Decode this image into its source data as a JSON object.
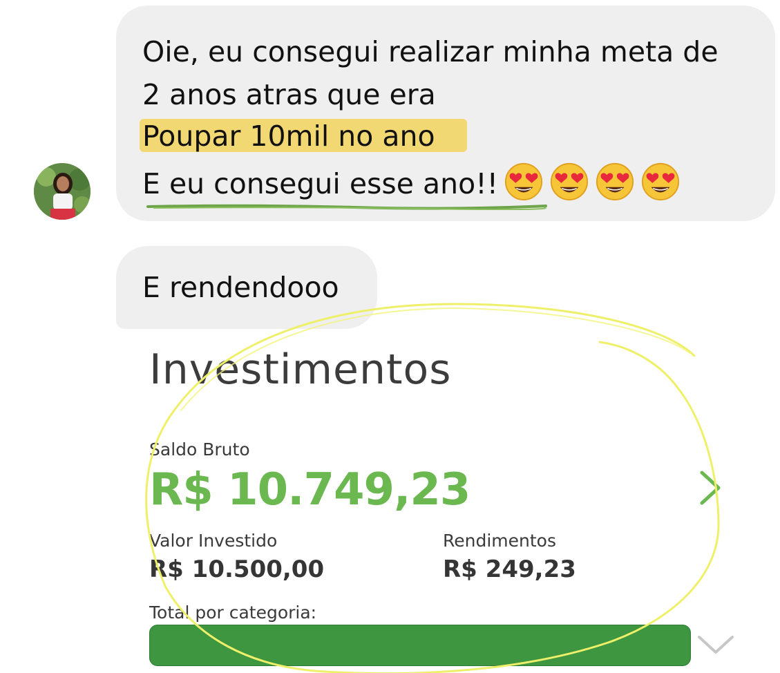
{
  "chat": {
    "message1": {
      "lines": [
        "Oie, eu consegui realizar minha meta de",
        "2 anos atras que era",
        "Poupar 10mil no ano",
        "E eu consegui esse ano!!"
      ],
      "emojis": [
        "heart-eyes-emoji",
        "heart-eyes-emoji",
        "heart-eyes-emoji",
        "heart-eyes-emoji"
      ]
    },
    "message2": {
      "text": "E rendendooo"
    }
  },
  "investments": {
    "title": "Investimentos",
    "saldo_label": "Saldo Bruto",
    "saldo_value": "R$ 10.749,23",
    "invested_label": "Valor Investido",
    "invested_value": "R$ 10.500,00",
    "yield_label": "Rendimentos",
    "yield_value": "R$ 249,23",
    "category_label": "Total por categoria:"
  },
  "colors": {
    "accent_green": "#6ab84f",
    "bar_green": "#3f9640",
    "highlight_yellow": "#f2d872",
    "annotation_yellow": "#eef06a"
  }
}
